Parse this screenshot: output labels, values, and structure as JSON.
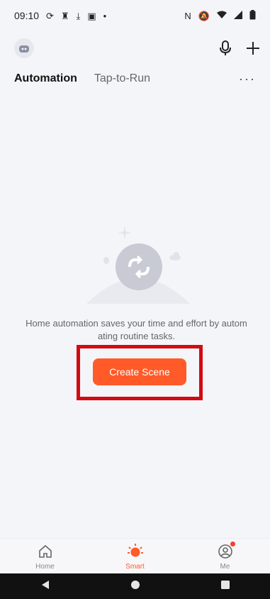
{
  "status_bar": {
    "time": "09:10",
    "left_icons": [
      "sync-icon",
      "person-icon",
      "download-done-icon",
      "gallery-icon",
      "dot-icon"
    ],
    "right_icons": [
      "nfc-icon",
      "mute-icon",
      "wifi-icon",
      "signal-icon",
      "battery-icon"
    ]
  },
  "header": {
    "avatar_icon": "robot-avatar-icon",
    "mic_icon": "microphone-icon",
    "add_icon": "plus-icon"
  },
  "tabs": [
    {
      "label": "Automation",
      "active": true
    },
    {
      "label": "Tap-to-Run",
      "active": false
    }
  ],
  "more_label": "···",
  "empty_state": {
    "message": "Home automation saves your time and effort by autom ating routine tasks.",
    "button_label": "Create Scene",
    "highlight_color": "#d20b12"
  },
  "accent_color": "#ff5a28",
  "bottom_nav": [
    {
      "label": "Home",
      "icon": "home-icon",
      "active": false
    },
    {
      "label": "Smart",
      "icon": "sun-icon",
      "active": true
    },
    {
      "label": "Me",
      "icon": "profile-icon",
      "active": false,
      "badge": true
    }
  ],
  "system_nav": [
    "back-icon",
    "home-circle-icon",
    "recents-icon"
  ]
}
